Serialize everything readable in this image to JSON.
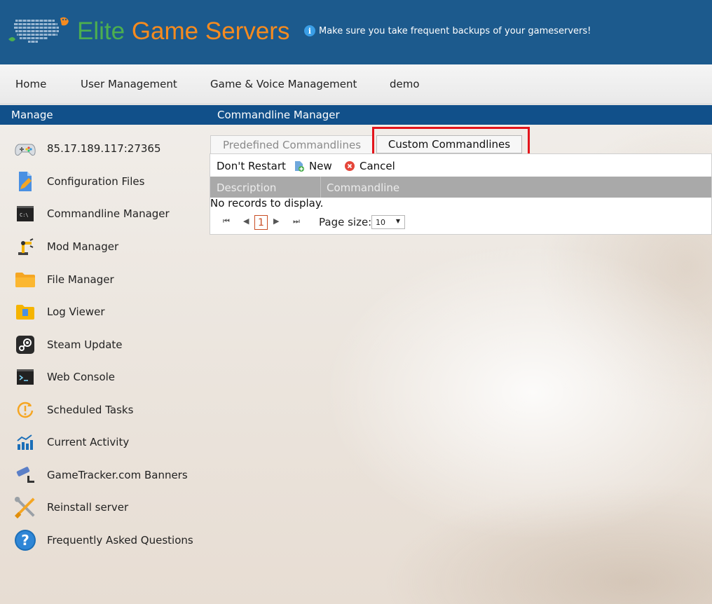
{
  "header": {
    "brand_word1": "Elite",
    "brand_word2": "Game Servers",
    "notice": "Make sure you take frequent backups of your gameservers!",
    "colors": {
      "header_bg": "#1c5a8d",
      "brand_green": "#4caf4f",
      "brand_orange": "#f68b1f"
    }
  },
  "topnav": {
    "items": [
      "Home",
      "User Management",
      "Game & Voice Management",
      "demo"
    ]
  },
  "sectionbar": {
    "left": "Manage",
    "right": "Commandline Manager"
  },
  "sidebar": {
    "items": [
      {
        "label": "85.17.189.117:27365",
        "icon": "gamepad-icon"
      },
      {
        "label": "Configuration Files",
        "icon": "edit-file-icon"
      },
      {
        "label": "Commandline Manager",
        "icon": "terminal-icon"
      },
      {
        "label": "Mod Manager",
        "icon": "robot-arm-icon"
      },
      {
        "label": "File Manager",
        "icon": "folder-icon"
      },
      {
        "label": "Log Viewer",
        "icon": "log-folder-icon"
      },
      {
        "label": "Steam Update",
        "icon": "steam-icon"
      },
      {
        "label": "Web Console",
        "icon": "console-icon"
      },
      {
        "label": "Scheduled Tasks",
        "icon": "scheduled-icon"
      },
      {
        "label": "Current Activity",
        "icon": "activity-chart-icon"
      },
      {
        "label": "GameTracker.com Banners",
        "icon": "camera-icon"
      },
      {
        "label": "Reinstall server",
        "icon": "tools-icon"
      },
      {
        "label": "Frequently Asked Questions",
        "icon": "help-icon"
      }
    ]
  },
  "main": {
    "tabs": [
      {
        "label": "Predefined Commandlines",
        "active": false
      },
      {
        "label": "Custom Commandlines",
        "active": true
      }
    ],
    "toolbar": {
      "dont_restart": "Don't Restart",
      "new": "New",
      "cancel": "Cancel"
    },
    "grid": {
      "columns": [
        "Description",
        "Commandline"
      ],
      "empty_message": "No records to display."
    },
    "pager": {
      "current_page": "1",
      "page_size_label": "Page size:",
      "page_size_value": "10"
    }
  }
}
